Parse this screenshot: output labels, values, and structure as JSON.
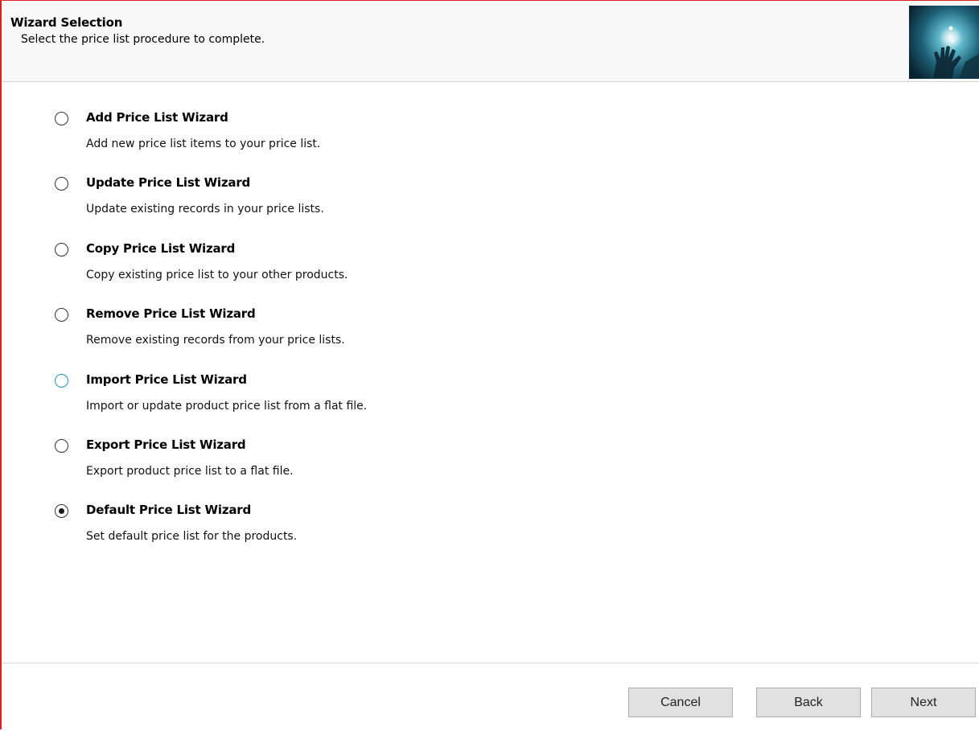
{
  "header": {
    "title": "Wizard Selection",
    "subtitle": "Select the price list procedure to complete.",
    "image_icon": "glowing-hand-image"
  },
  "options": [
    {
      "title": "Add Price List Wizard",
      "description": "Add new price list items to your price list.",
      "selected": false
    },
    {
      "title": "Update Price List Wizard",
      "description": "Update existing records in your price lists.",
      "selected": false
    },
    {
      "title": "Copy Price List Wizard",
      "description": "Copy existing price list to your other products.",
      "selected": false
    },
    {
      "title": "Remove Price List Wizard",
      "description": "Remove existing records from your price lists.",
      "selected": false
    },
    {
      "title": "Import Price List Wizard",
      "description": "Import or update product price list from a flat file.",
      "selected": false,
      "hover": true
    },
    {
      "title": "Export Price List Wizard",
      "description": "Export product price list to a flat file.",
      "selected": false
    },
    {
      "title": "Default Price List Wizard",
      "description": "Set default price list for the products.",
      "selected": true
    }
  ],
  "footer": {
    "cancel_label": "Cancel",
    "back_label": "Back",
    "next_label": "Next"
  },
  "colors": {
    "window_border": "#e02020",
    "hover_radio": "#1e8fd7",
    "button_face": "#e1e1e1"
  }
}
